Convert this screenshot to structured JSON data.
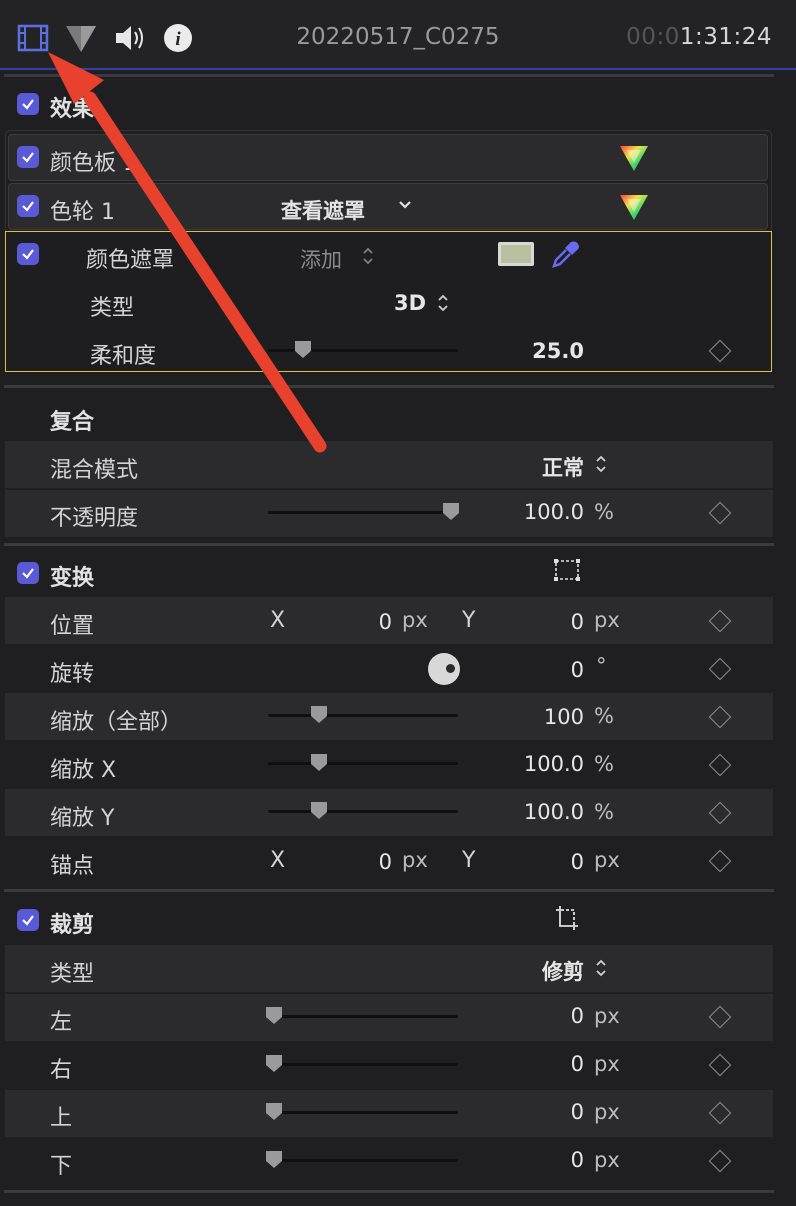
{
  "header": {
    "clip_name": "20220517_C0275",
    "timecode_dim": "00:0",
    "timecode_bright": "1:31:24",
    "icons": [
      "film-icon",
      "color-triangle-icon",
      "speaker-icon",
      "info-icon"
    ]
  },
  "effects": {
    "section_label": "效果",
    "color_board": {
      "label": "颜色板 1"
    },
    "color_wheels": {
      "label": "色轮 1",
      "mask_menu": "查看遮罩"
    },
    "color_mask": {
      "label": "颜色遮罩",
      "mode_value": "添加",
      "swatch_color": "#b9c0a0",
      "type_label": "类型",
      "type_value": "3D",
      "softness_label": "柔和度",
      "softness_value": "25.0"
    }
  },
  "compositing": {
    "section_label": "复合",
    "blend_mode_label": "混合模式",
    "blend_mode_value": "正常",
    "opacity_label": "不透明度",
    "opacity_value": "100.0",
    "opacity_unit": "%"
  },
  "transform": {
    "section_label": "变换",
    "position_label": "位置",
    "position_x_axis": "X",
    "position_x_value": "0",
    "position_x_unit": "px",
    "position_y_axis": "Y",
    "position_y_value": "0",
    "position_y_unit": "px",
    "rotation_label": "旋转",
    "rotation_value": "0",
    "rotation_unit": "°",
    "scale_all_label": "缩放（全部）",
    "scale_all_value": "100",
    "scale_all_unit": "%",
    "scale_x_label": "缩放 X",
    "scale_x_value": "100.0",
    "scale_x_unit": "%",
    "scale_y_label": "缩放 Y",
    "scale_y_value": "100.0",
    "scale_y_unit": "%",
    "anchor_label": "锚点",
    "anchor_x_axis": "X",
    "anchor_x_value": "0",
    "anchor_x_unit": "px",
    "anchor_y_axis": "Y",
    "anchor_y_value": "0",
    "anchor_y_unit": "px"
  },
  "crop": {
    "section_label": "裁剪",
    "type_label": "类型",
    "type_value": "修剪",
    "left_label": "左",
    "left_value": "0",
    "right_label": "右",
    "right_value": "0",
    "top_label": "上",
    "top_value": "0",
    "bottom_label": "下",
    "bottom_value": "0",
    "unit": "px"
  },
  "colors": {
    "accent": "#5a5ad6",
    "highlight_border": "#e2c23a",
    "annotation_arrow": "#e8412e"
  }
}
